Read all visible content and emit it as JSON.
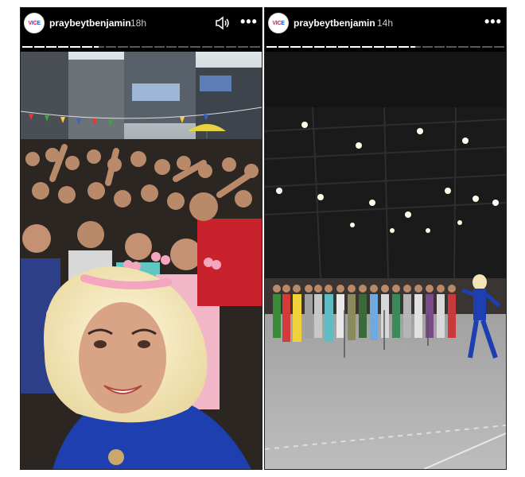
{
  "stories": [
    {
      "username": "praybeytbenjamin",
      "avatar_text": "VICE",
      "time": "18h",
      "has_sound": true,
      "progress": [
        1,
        1,
        1,
        1,
        1,
        1,
        0.4,
        0,
        0,
        0,
        0,
        0,
        0,
        0,
        0,
        0,
        0,
        0,
        0,
        0
      ],
      "icons": [
        "sound-icon",
        "more-options-icon"
      ]
    },
    {
      "username": "praybeytbenjamin",
      "avatar_text": "VICE",
      "time": "14h",
      "has_sound": false,
      "progress": [
        1,
        1,
        1,
        1,
        1,
        1,
        1,
        1,
        1,
        1,
        1,
        1,
        0.5,
        0,
        0,
        0,
        0,
        0,
        0,
        0
      ],
      "icons": [
        "more-options-icon"
      ]
    }
  ],
  "colors": {
    "header_bg": "#000000",
    "text": "#ffffff",
    "time": "#c9c9c9",
    "stage_floor": "#a9a9a9",
    "performer_suit": "#1d3fb0"
  }
}
